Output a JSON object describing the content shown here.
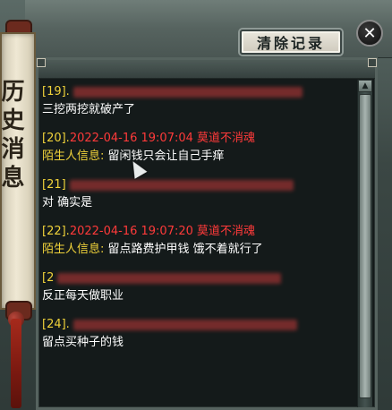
{
  "banner": {
    "title": "历史消息"
  },
  "header": {
    "clear_button_label": "清除记录",
    "close_glyph": "✕"
  },
  "messages": [
    {
      "index": "[19].",
      "timestamp": "",
      "name": "",
      "sender_label": "",
      "text": "三挖两挖就破产了"
    },
    {
      "index": "[20].",
      "timestamp": "2022-04-16 19:07:04",
      "name": "莫道不消魂",
      "sender_label": "陌生人信息:",
      "text": "留闲钱只会让自己手痒"
    },
    {
      "index": "[21]",
      "timestamp": "",
      "name": "",
      "sender_label": "",
      "text": "对 确实是"
    },
    {
      "index": "[22].",
      "timestamp": "2022-04-16 19:07:20",
      "name": "莫道不消魂",
      "sender_label": "陌生人信息:",
      "text": "留点路费护甲钱 饿不着就行了"
    },
    {
      "index": "[2",
      "timestamp": "",
      "name": "",
      "sender_label": "",
      "text": "反正每天做职业"
    },
    {
      "index": "[24].",
      "timestamp": "",
      "name": "",
      "sender_label": "",
      "text": "留点买种子的钱"
    }
  ],
  "colors": {
    "index": "#f0d23a",
    "timestamp": "#ff3a3a",
    "text": "#ffffff",
    "panel_bg": "#141a1a"
  },
  "icons": {
    "close": "close-icon",
    "scroll_up": "arrow-up-icon",
    "scroll_down": "arrow-down-icon",
    "cursor": "mouse-cursor-icon"
  }
}
